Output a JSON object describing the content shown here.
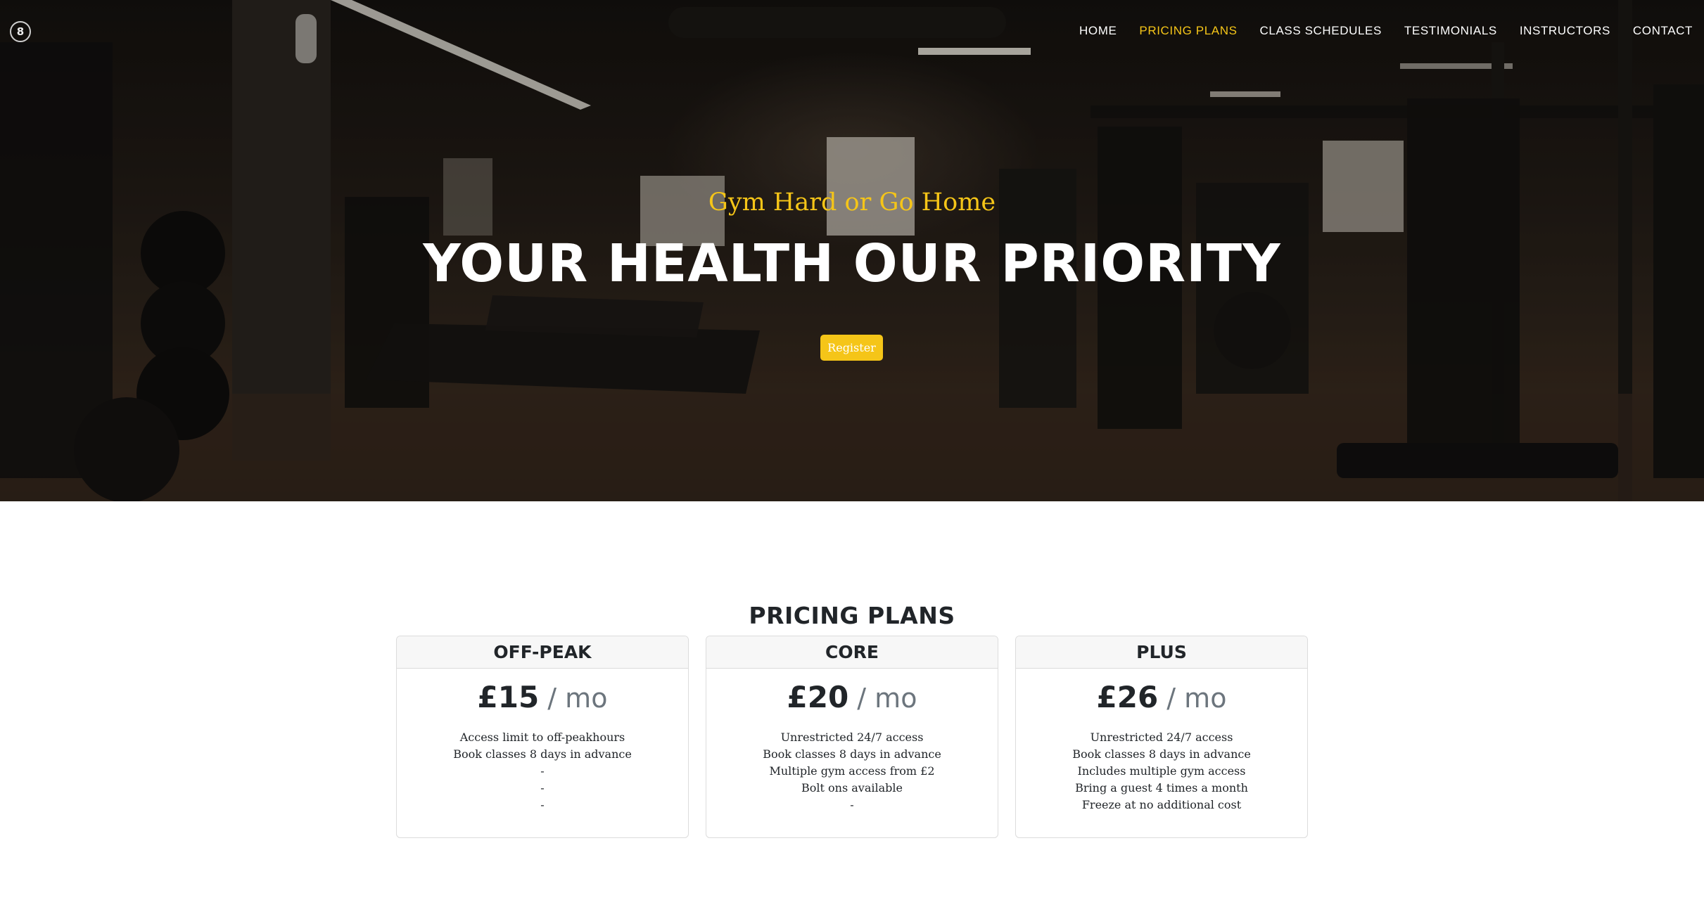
{
  "logo": {
    "glyph": "8"
  },
  "nav": {
    "items": [
      {
        "label": "HOME",
        "active": false
      },
      {
        "label": "PRICING PLANS",
        "active": true
      },
      {
        "label": "CLASS SCHEDULES",
        "active": false
      },
      {
        "label": "TESTIMONIALS",
        "active": false
      },
      {
        "label": "INSTRUCTORS",
        "active": false
      },
      {
        "label": "CONTACT",
        "active": false
      }
    ]
  },
  "hero": {
    "tagline": "Gym Hard or Go Home",
    "headline": "YOUR HEALTH OUR PRIORITY",
    "register_label": "Register"
  },
  "pricing": {
    "title": "PRICING PLANS",
    "plans": [
      {
        "name": "OFF-PEAK",
        "price": "£15",
        "period": " / mo",
        "features": [
          "Access limit to off-peakhours",
          "Book classes 8 days in advance",
          "-",
          "-",
          "-"
        ]
      },
      {
        "name": "CORE",
        "price": "£20",
        "period": " / mo",
        "features": [
          "Unrestricted 24/7 access",
          "Book classes 8 days in advance",
          "Multiple gym access from £2",
          "Bolt ons available",
          "-"
        ]
      },
      {
        "name": "PLUS",
        "price": "£26",
        "period": " / mo",
        "features": [
          "Unrestricted 24/7 access",
          "Book classes 8 days in advance",
          "Includes multiple gym access",
          "Bring a guest 4 times a month",
          "Freeze at no additional cost"
        ]
      }
    ]
  },
  "colors": {
    "accent": "#f5c518",
    "text": "#212529",
    "muted": "#6c757d",
    "card_header_bg": "#f7f7f7"
  }
}
